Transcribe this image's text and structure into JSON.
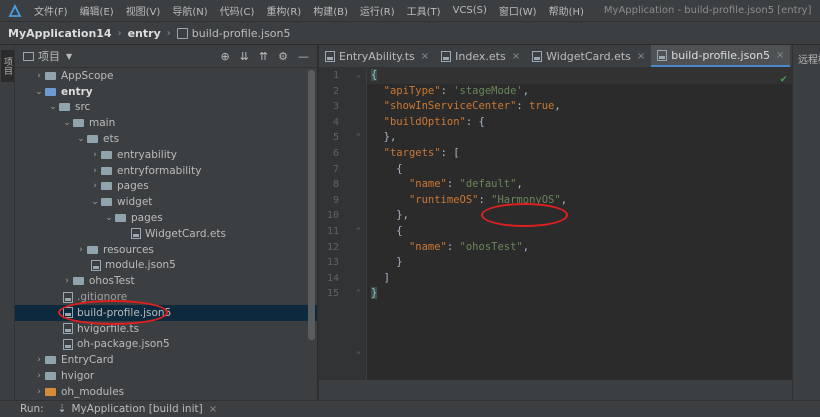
{
  "menubar": {
    "items": [
      "文件(F)",
      "编辑(E)",
      "视图(V)",
      "导航(N)",
      "代码(C)",
      "重构(R)",
      "构建(B)",
      "运行(R)",
      "工具(T)",
      "VCS(S)",
      "窗口(W)",
      "帮助(H)"
    ],
    "window_title": "MyApplication - build-profile.json5 [entry]"
  },
  "breadcrumb": {
    "project": "MyApplication14",
    "module": "entry",
    "file": "build-profile.json5"
  },
  "left_strip": {
    "label": "项目"
  },
  "project_panel": {
    "title": "项目",
    "tree": [
      {
        "label": "AppScope",
        "type": "folder",
        "arrow": "›"
      },
      {
        "label": "entry",
        "type": "folder",
        "arrow": "⌄",
        "bold": true
      },
      {
        "label": "src",
        "type": "folder",
        "arrow": "⌄"
      },
      {
        "label": "main",
        "type": "folder",
        "arrow": "⌄"
      },
      {
        "label": "ets",
        "type": "folder",
        "arrow": "⌄"
      },
      {
        "label": "entryability",
        "type": "folder",
        "arrow": "›"
      },
      {
        "label": "entryformability",
        "type": "folder",
        "arrow": "›"
      },
      {
        "label": "pages",
        "type": "folder",
        "arrow": "›"
      },
      {
        "label": "widget",
        "type": "folder",
        "arrow": "⌄"
      },
      {
        "label": "pages",
        "type": "folder",
        "arrow": "⌄"
      },
      {
        "label": "WidgetCard.ets",
        "type": "file",
        "arrow": ""
      },
      {
        "label": "resources",
        "type": "folder",
        "arrow": "›"
      },
      {
        "label": "module.json5",
        "type": "file",
        "arrow": ""
      },
      {
        "label": "ohosTest",
        "type": "folder",
        "arrow": "›"
      },
      {
        "label": ".gitignore",
        "type": "file",
        "arrow": ""
      },
      {
        "label": "build-profile.json5",
        "type": "file",
        "arrow": "",
        "selected": true
      },
      {
        "label": "hvigorfile.ts",
        "type": "file",
        "arrow": ""
      },
      {
        "label": "oh-package.json5",
        "type": "file",
        "arrow": ""
      },
      {
        "label": "EntryCard",
        "type": "folder",
        "arrow": "›"
      },
      {
        "label": "hvigor",
        "type": "folder",
        "arrow": "›"
      },
      {
        "label": "oh_modules",
        "type": "folder-orange",
        "arrow": "›"
      }
    ]
  },
  "editor": {
    "tabs": [
      {
        "label": "EntryAbility.ts",
        "active": false
      },
      {
        "label": "Index.ets",
        "active": false
      },
      {
        "label": "WidgetCard.ets",
        "active": false
      },
      {
        "label": "build-profile.json5",
        "active": true
      }
    ],
    "line_numbers": [
      "1",
      "2",
      "3",
      "4",
      "5",
      "6",
      "7",
      "8",
      "9",
      "10",
      "11",
      "12",
      "13",
      "14",
      "15"
    ],
    "code": {
      "l1": "{",
      "l2_key": "\"apiType\"",
      "l2_val": "'stageMode'",
      "l3_key": "\"showInServiceCenter\"",
      "l3_val": "true",
      "l4_key": "\"buildOption\"",
      "l4_val": "{",
      "l5": "},",
      "l6_key": "\"targets\"",
      "l6_val": "[",
      "l7": "{",
      "l8_key": "\"name\"",
      "l8_val": "\"default\"",
      "l9_key": "\"runtimeOS\"",
      "l9_val": "\"HarmonyOS\"",
      "l10": "},",
      "l11": "{",
      "l12_key": "\"name\"",
      "l12_val": "\"ohosTest\"",
      "l13": "}",
      "l14": "]",
      "l15": "}"
    }
  },
  "right_strip": {
    "label": "远程模"
  },
  "runbar": {
    "label": "Run:",
    "config": "MyApplication [build init]"
  }
}
